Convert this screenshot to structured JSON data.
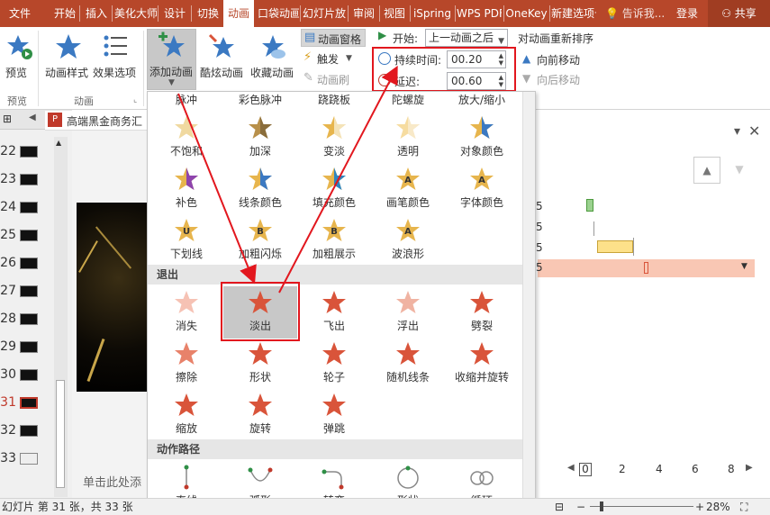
{
  "tabs": [
    "文件",
    "开始",
    "插入",
    "美化大师",
    "设计",
    "切换",
    "动画",
    "口袋动画",
    "幻灯片放映",
    "审阅",
    "视图",
    "iSpring",
    "WPS PDF",
    "OneKey",
    "新建选项卡"
  ],
  "active_tab": "动画",
  "tell_me": "告诉我...",
  "login": "登录",
  "share": "共享",
  "ribbon": {
    "preview_btn": "预览",
    "preview_group": "预览",
    "anim_style": "动画样式",
    "effect_options": "效果选项",
    "anim_group": "动画",
    "add_anim": "添加动画",
    "cool_anim": "酷炫动画",
    "fav_anim": "收藏动画",
    "anim_pane": "动画窗格",
    "trigger": "触发",
    "anim_brush": "动画刷",
    "start_label": "开始:",
    "start_value": "上一动画之后",
    "duration_label": "持续时间:",
    "duration_value": "00.20",
    "delay_label": "延迟:",
    "delay_value": "00.60",
    "reorder_title": "对动画重新排序",
    "move_earlier": "向前移动",
    "move_later": "向后移动"
  },
  "slide_numbers": [
    "22",
    "23",
    "24",
    "25",
    "26",
    "27",
    "28",
    "29",
    "30",
    "31",
    "32",
    "33"
  ],
  "current_slide": "31",
  "file_tab_title": "高端黑金商务汇",
  "slide_hint": "单击此处添",
  "status_text": "幻灯片 第 31 张，共 33 张",
  "zoom": "28%",
  "gallery": {
    "top_row": [
      "脉冲",
      "彩色脉冲",
      "跷跷板",
      "陀螺旋",
      "放大/缩小"
    ],
    "emphasis": [
      [
        "不饱和",
        "加深",
        "变淡",
        "透明",
        "对象颜色"
      ],
      [
        "补色",
        "线条颜色",
        "填充颜色",
        "画笔颜色",
        "字体颜色"
      ],
      [
        "下划线",
        "加粗闪烁",
        "加粗展示",
        "波浪形"
      ]
    ],
    "exit_header": "退出",
    "exit": [
      [
        "消失",
        "淡出",
        "飞出",
        "浮出",
        "劈裂"
      ],
      [
        "擦除",
        "形状",
        "轮子",
        "随机线条",
        "收缩并旋转"
      ],
      [
        "缩放",
        "旋转",
        "弹跳"
      ]
    ],
    "path_header": "动作路径",
    "paths": [
      "直线",
      "弧形",
      "转弯",
      "形状",
      "循环"
    ]
  },
  "timeline_rows": [
    "5",
    "5",
    "5",
    "5"
  ],
  "timeline_ticks": [
    "0",
    "2",
    "4",
    "6",
    "8"
  ],
  "colors": {
    "accent": "#b7472a",
    "highlight": "#e2171e",
    "exit_star": "#d9543a",
    "emph_star": "#e7b54d"
  }
}
